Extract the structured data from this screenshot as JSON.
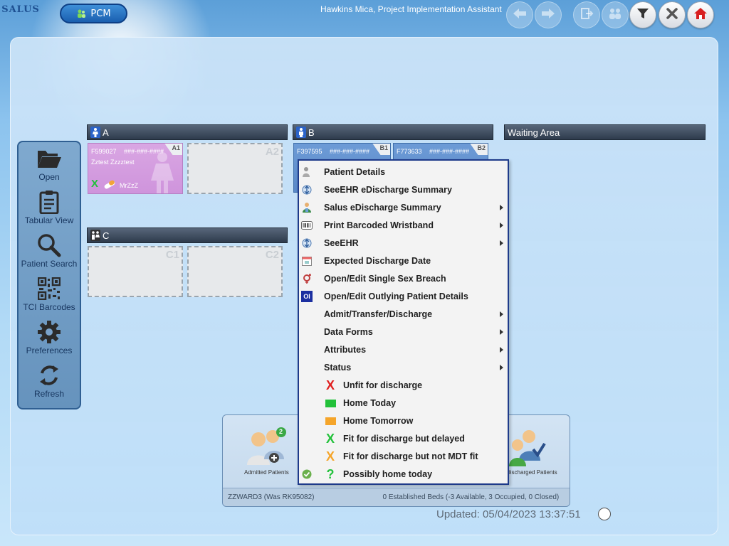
{
  "app": {
    "logo_text": "SALUS",
    "module_label": "PCM",
    "user_title": "Hawkins Mica, Project Implementation Assistant"
  },
  "toolbar": {
    "buttons": [
      "back-icon",
      "forward-icon",
      "logout-icon",
      "switch-user-icon",
      "filter-icon",
      "close-icon",
      "home-icon"
    ]
  },
  "sidebar": {
    "items": [
      {
        "label": "Open",
        "icon": "folder-icon"
      },
      {
        "label": "Tabular View",
        "icon": "clipboard-icon"
      },
      {
        "label": "Patient Search",
        "icon": "magnifier-icon"
      },
      {
        "label": "TCI Barcodes",
        "icon": "qr-code-icon"
      },
      {
        "label": "Preferences",
        "icon": "gear-icon"
      },
      {
        "label": "Refresh",
        "icon": "refresh-icon"
      }
    ]
  },
  "wards": {
    "a": {
      "title": "A"
    },
    "b": {
      "title": "B"
    },
    "c": {
      "title": "C"
    },
    "waiting": {
      "title": "Waiting Area"
    }
  },
  "beds": {
    "a1": {
      "id": "A1",
      "patient_no": "F599027",
      "nhs": "###-###-####",
      "name": "Zztest Zzzztest",
      "consultant": "MrZzZ",
      "status_mark": "X"
    },
    "a2": {
      "id": "A2"
    },
    "b1": {
      "id": "B1",
      "patient_no": "F397595",
      "nhs": "###-###-####"
    },
    "b2": {
      "id": "B2",
      "patient_no": "F773633",
      "nhs": "###-###-####"
    },
    "c1": {
      "id": "C1"
    },
    "c2": {
      "id": "C2"
    }
  },
  "context_menu": {
    "items": [
      {
        "label": "Patient Details",
        "icon": "patient-icon",
        "submenu": false
      },
      {
        "label": "SeeEHR eDischarge Summary",
        "icon": "seeehr-icon",
        "submenu": false
      },
      {
        "label": "Salus eDischarge Summary",
        "icon": "doctor-icon",
        "submenu": true
      },
      {
        "label": "Print Barcoded Wristband",
        "icon": "barcode-icon",
        "submenu": true
      },
      {
        "label": "SeeEHR",
        "icon": "seeehr-icon",
        "submenu": true
      },
      {
        "label": "Expected Discharge Date",
        "icon": "calendar-icon",
        "submenu": false
      },
      {
        "label": "Open/Edit Single Sex Breach",
        "icon": "gender-icon",
        "submenu": false
      },
      {
        "label": "Open/Edit Outlying Patient Details",
        "icon": "ol-icon",
        "icon_text": "Ol",
        "submenu": false
      },
      {
        "label": "Admit/Transfer/Discharge",
        "icon": "none",
        "submenu": true
      },
      {
        "label": "Data Forms",
        "icon": "none",
        "submenu": true
      },
      {
        "label": "Attributes",
        "icon": "none",
        "submenu": true
      },
      {
        "label": "Status",
        "icon": "none",
        "submenu": true
      }
    ],
    "status_options": [
      {
        "label": "Unfit for discharge",
        "icon": "red-x-icon",
        "glyph": "X",
        "color": "#e02020"
      },
      {
        "label": "Home Today",
        "icon": "green-square-icon",
        "glyph": "",
        "color": "#22c13a"
      },
      {
        "label": "Home Tomorrow",
        "icon": "orange-square-icon",
        "glyph": "",
        "color": "#f5a52a"
      },
      {
        "label": "Fit for discharge but delayed",
        "icon": "green-x-icon",
        "glyph": "X",
        "color": "#22c13a"
      },
      {
        "label": "Fit for discharge but not MDT fit",
        "icon": "orange-x-icon",
        "glyph": "X",
        "color": "#f5a52a"
      },
      {
        "label": "Possibly home today",
        "icon": "green-question-icon",
        "glyph": "?",
        "color": "#22c13a",
        "selected": true
      }
    ]
  },
  "summary": {
    "admitted_label": "Admitted Patients",
    "admitted_badge": "2",
    "discharged_label": "Discharged Patients",
    "ward_code": "ZZWARD3 (Was RK95082)",
    "beds_summary": "0 Established Beds (-3 Available, 3 Occupied, 0 Closed)"
  },
  "footer": {
    "updated": "Updated: 05/04/2023 13:37:51"
  },
  "colors": {
    "accent": "#1e3a8a",
    "bed_female": "#d9a6e3",
    "bed_male": "#6d9bd6"
  }
}
